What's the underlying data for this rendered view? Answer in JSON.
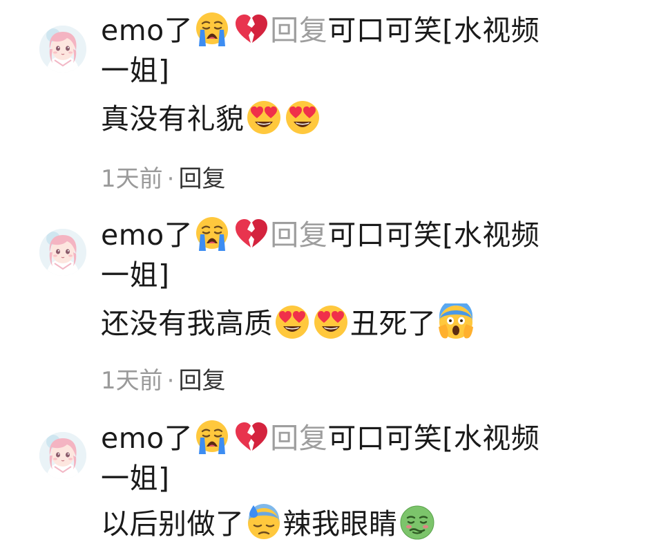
{
  "comments": [
    {
      "author": "emo了",
      "reply_word": "回复",
      "reply_target": "可口可笑[水视频一姐]",
      "reply_target_line1": "可口可笑[水视频",
      "reply_target_line2": "一姐]",
      "text_parts": [
        "真没有礼貌"
      ],
      "content_emojis": [
        "heart-eyes-icon",
        "heart-eyes-icon"
      ],
      "time": "1天前",
      "separator": "·",
      "reply_button": "回复"
    },
    {
      "author": "emo了",
      "reply_word": "回复",
      "reply_target": "可口可笑[水视频一姐]",
      "reply_target_line1": "可口可笑[水视频",
      "reply_target_line2": "一姐]",
      "text_parts": [
        "还没有我高质",
        "丑死了"
      ],
      "content_emojis": [
        "heart-eyes-icon",
        "heart-eyes-icon",
        "screaming-face-icon"
      ],
      "time": "1天前",
      "separator": "·",
      "reply_button": "回复"
    },
    {
      "author": "emo了",
      "reply_word": "回复",
      "reply_target": "可口可笑[水视频一姐]",
      "reply_target_line1": "可口可笑[水视频",
      "reply_target_line2": "一姐]",
      "text_parts": [
        "以后别做了",
        "辣我眼睛"
      ],
      "content_emojis": [
        "sweat-face-icon",
        "nauseated-face-icon"
      ]
    }
  ],
  "name_emojis": [
    "crying-face-icon",
    "broken-heart-icon"
  ],
  "colors": {
    "text": "#1a1a1a",
    "muted": "#9e9e9e",
    "reply_button": "#333333"
  }
}
